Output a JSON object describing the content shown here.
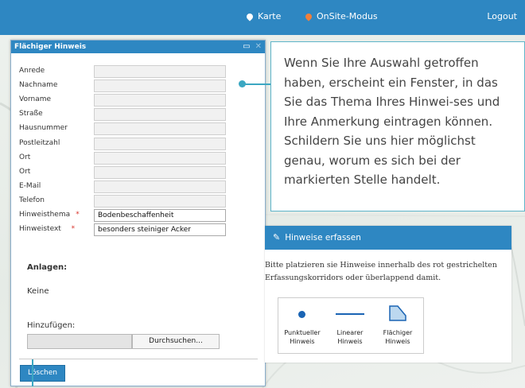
{
  "topbar": {
    "karte": "Karte",
    "onsite": "OnSite-Modus",
    "logout": "Logout"
  },
  "window": {
    "title": "Flächiger Hinweis",
    "fields": [
      {
        "label": "Anrede",
        "value": "",
        "required": false
      },
      {
        "label": "Nachname",
        "value": "",
        "required": false
      },
      {
        "label": "Vorname",
        "value": "",
        "required": false
      },
      {
        "label": "Straße",
        "value": "",
        "required": false
      },
      {
        "label": "Hausnummer",
        "value": "",
        "required": false
      },
      {
        "label": "Postleitzahl",
        "value": "",
        "required": false
      },
      {
        "label": "Ort",
        "value": "",
        "required": false
      },
      {
        "label": "Ort",
        "value": "",
        "required": false
      },
      {
        "label": "E-Mail",
        "value": "",
        "required": false
      },
      {
        "label": "Telefon",
        "value": "",
        "required": false
      },
      {
        "label": "Hinweisthema",
        "value": "Bodenbeschaffenheit",
        "required": true
      },
      {
        "label": "Hinweistext",
        "value": "besonders steiniger Acker",
        "required": true
      }
    ],
    "attachments_heading": "Anlagen:",
    "attachments_none": "Keine",
    "add_label": "Hinzufügen:",
    "browse_label": "Durchsuchen...",
    "delete_label": "Löschen"
  },
  "callout": {
    "text": "Wenn Sie Ihre Auswahl getroffen haben, erscheint ein Fenster, in das Sie das Thema Ihres Hinwei-ses und Ihre Anmerkung eintragen können. Schildern Sie uns hier möglichst genau, worum es sich bei der markierten Stelle handelt."
  },
  "panel": {
    "title": "Hinweise erfassen",
    "text": "Bitte platzieren sie Hinweise innerhalb des rot gestrichelten Erfassungskorridors oder überlappend damit.",
    "types": [
      {
        "label1": "Punktueller",
        "label2": "Hinweis",
        "icon": "point-icon"
      },
      {
        "label1": "Linearer",
        "label2": "Hinweis",
        "icon": "line-icon"
      },
      {
        "label1": "Flächiger",
        "label2": "Hinweis",
        "icon": "polygon-icon"
      }
    ]
  },
  "colors": {
    "accent": "#2e87c2",
    "callout_border": "#5eb4c9",
    "required": "#d9342b",
    "onsite_pin": "#f07f3a"
  }
}
